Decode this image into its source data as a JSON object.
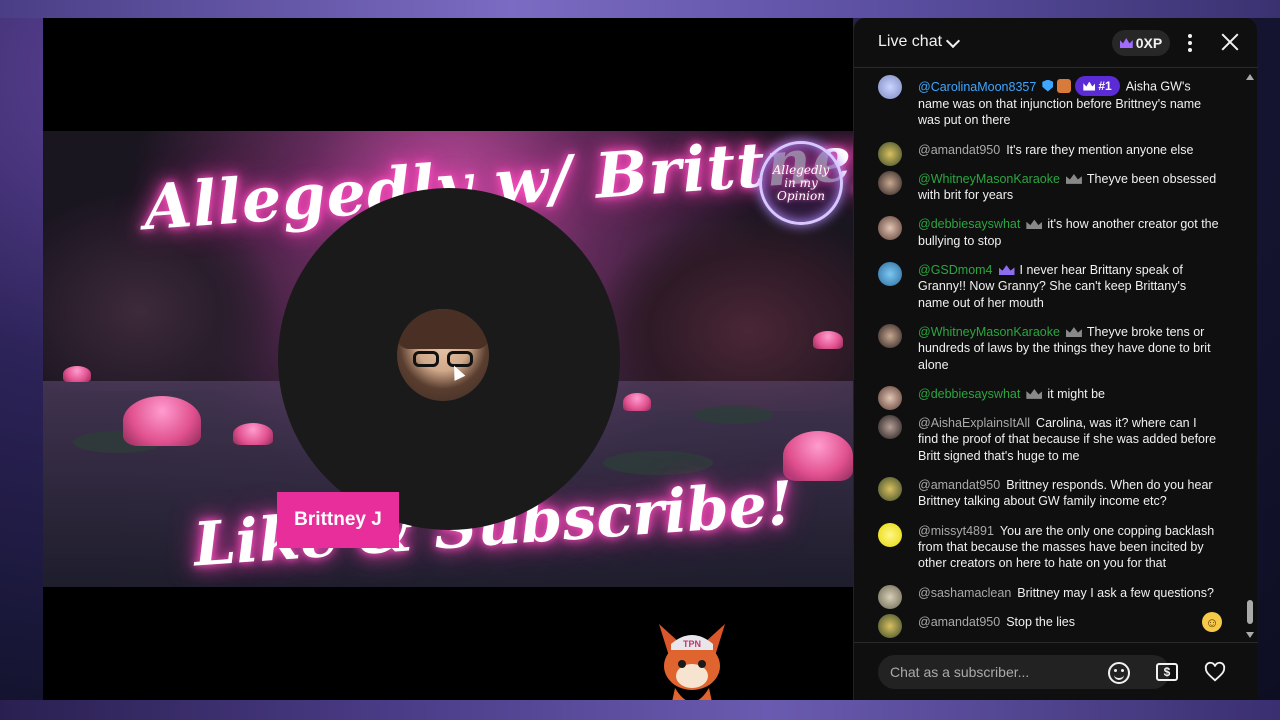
{
  "video": {
    "banner_title": "Allegedly w/ Brittney J",
    "banner_subtitle": "Like & Subscribe!",
    "badge_text": "Allegedly in my Opinion",
    "name_tag": "Brittney J",
    "mascot_cap": "TPN"
  },
  "chat": {
    "title": "Live chat",
    "xp_label": "0XP",
    "input_placeholder": "Chat as a subscriber...",
    "money_label": "$",
    "messages": [
      {
        "author": "@CarolinaMoon8357",
        "rank": "#1",
        "text": "Aisha GW's name was on that injunction before Brittney's name was put on there"
      },
      {
        "author": "@amandat950",
        "text": "It's rare they mention anyone else"
      },
      {
        "author": "@WhitneyMasonKaraoke",
        "text": "Theyve been obsessed with brit for years"
      },
      {
        "author": "@debbiesayswhat",
        "text": "it's how another creator got the bullying to stop"
      },
      {
        "author": "@GSDmom4",
        "text": "I never hear Brittany speak of Granny!! Now Granny? She can't keep Brittany's name out of her mouth"
      },
      {
        "author": "@WhitneyMasonKaraoke",
        "text": "Theyve broke tens or hundreds of laws by the things they have done to brit alone"
      },
      {
        "author": "@debbiesayswhat",
        "text": "it might be"
      },
      {
        "author": "@AishaExplainsItAll",
        "text": "Carolina, was it? where can I find the proof of that because if she was added before Britt signed that's huge to me"
      },
      {
        "author": "@amandat950",
        "text": "Brittney responds. When do you hear Brittney talking about GW family income etc?"
      },
      {
        "author": "@missyt4891",
        "text": "You are the only one copping backlash from that because the masses have been incited by other creators on here to hate on you for that"
      },
      {
        "author": "@sashamaclean",
        "text": "Brittney may I ask a few questions?"
      },
      {
        "author": "@amandat950",
        "text": "Stop the lies"
      }
    ]
  },
  "colors": {
    "chat_bg": "#0f0f0f",
    "name_tag_bg": "#e72e9a",
    "rank_pill": "#5b2bd6",
    "moderator_blue": "#3ea6ff",
    "member_green": "#2ba640"
  }
}
